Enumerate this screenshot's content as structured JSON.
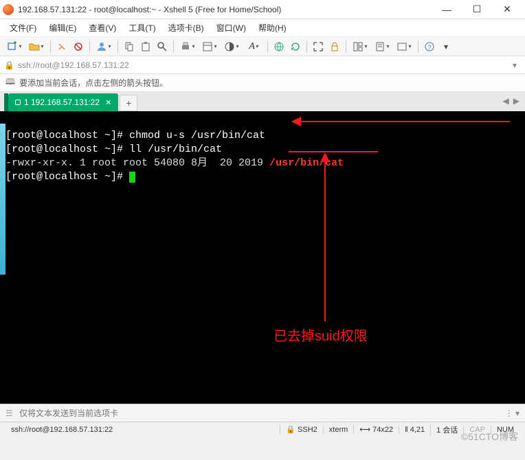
{
  "window": {
    "title": "192.168.57.131:22 - root@localhost:~ - Xshell 5 (Free for Home/School)"
  },
  "menu": {
    "file": "文件(F)",
    "edit": "编辑(E)",
    "view": "查看(V)",
    "tools": "工具(T)",
    "tab": "选项卡(B)",
    "window": "窗口(W)",
    "help": "帮助(H)"
  },
  "address": {
    "url": "ssh://root@192.168.57.131:22"
  },
  "tip": {
    "text": "要添加当前会话，点击左侧的箭头按钮。"
  },
  "tab": {
    "label": "1 192.168.57.131:22"
  },
  "terminal": {
    "line1_prompt": "[root@localhost ~]# ",
    "line1_cmd": "chmod u-s /usr/bin/cat",
    "line2_prompt": "[root@localhost ~]# ",
    "line2_cmd": "ll /usr/bin/cat",
    "line3_pre": "-rwxr-xr-x. 1 root root 54080 8月  20 2019 ",
    "line3_hl": "/usr/bin/cat",
    "line4_prompt": "[root@localhost ~]# "
  },
  "annotation": {
    "text": "已去掉suid权限"
  },
  "footerinput": {
    "placeholder": "仅将文本发送到当前选项卡"
  },
  "status": {
    "conn": "ssh://root@192.168.57.131:22",
    "s1": "SSH2",
    "s2": "xterm",
    "s3": "74x22",
    "s4": "4,21",
    "s5": "1 会话",
    "cap": "CAP",
    "num": "NUM"
  },
  "watermark": "©51CTO博客"
}
